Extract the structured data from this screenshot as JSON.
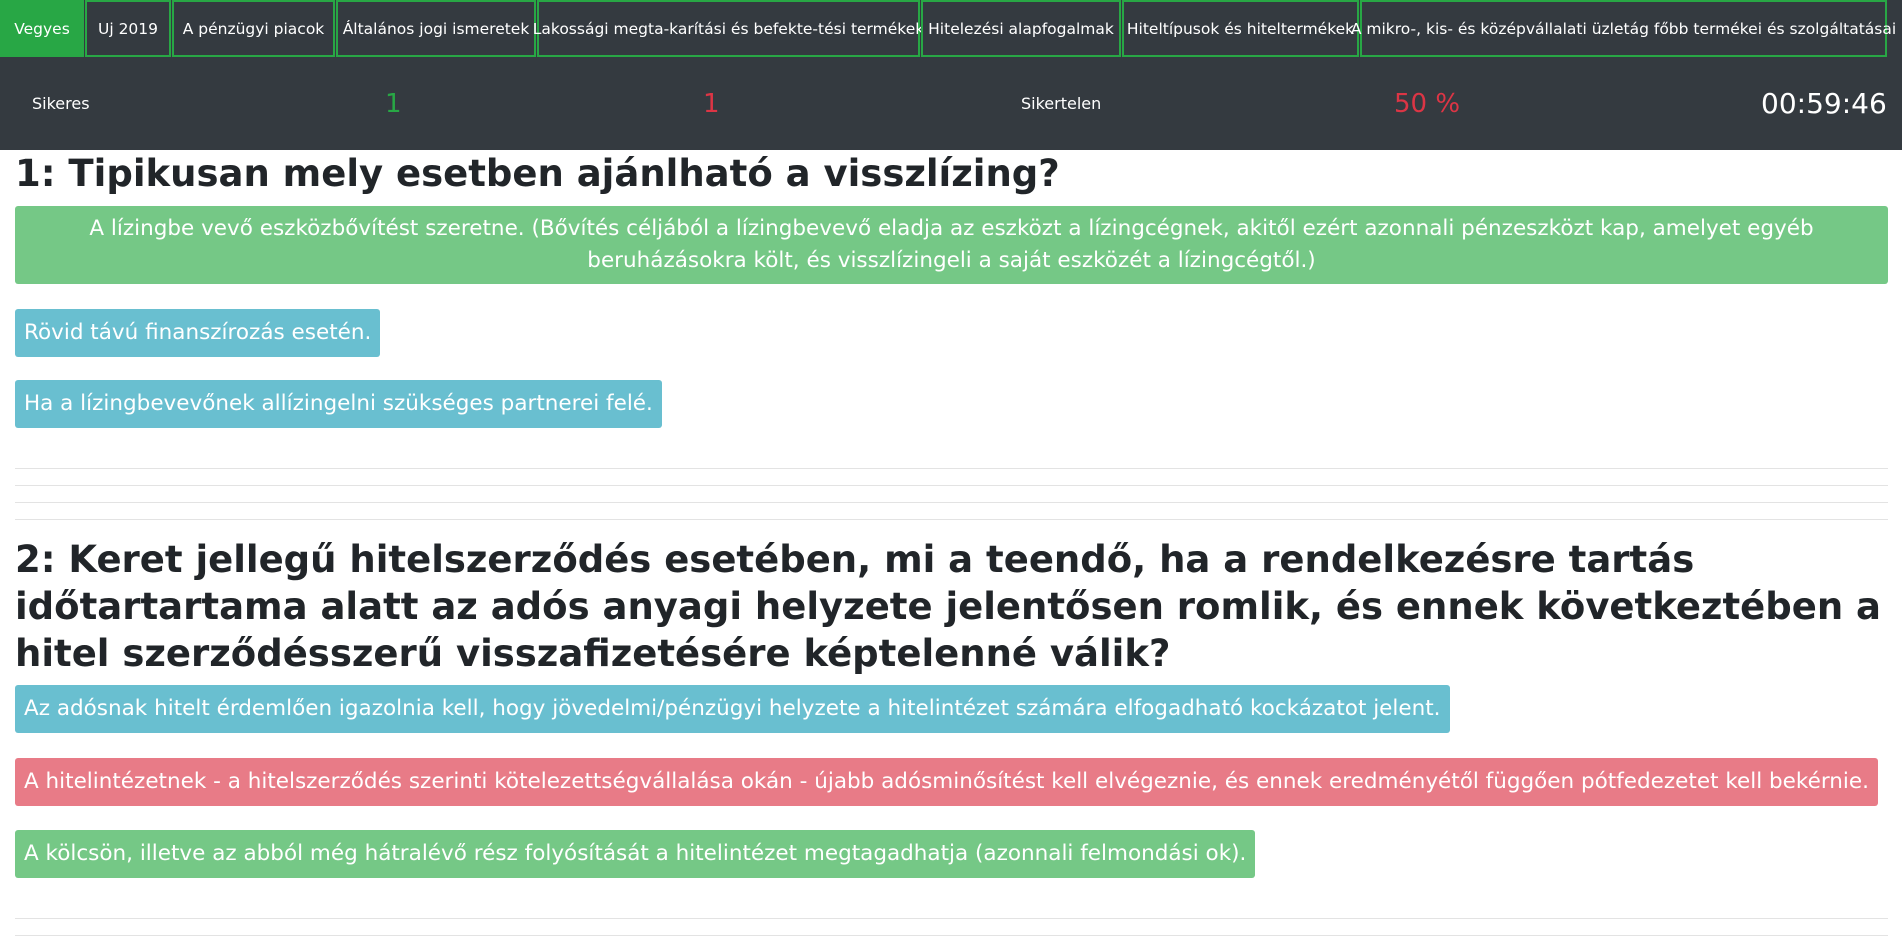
{
  "nav": {
    "tabs": [
      {
        "label": "Vegyes",
        "active": true
      },
      {
        "label": "Uj 2019",
        "active": false
      },
      {
        "label": "A pénzügyi piacok",
        "active": false
      },
      {
        "label": "Általános jogi ismeretek",
        "active": false
      },
      {
        "label": "Lakossági megta-karítási és befekte-tési termékek",
        "active": false
      },
      {
        "label": "Hitelezési alapfogalmak",
        "active": false
      },
      {
        "label": "Hiteltípusok és hiteltermékek",
        "active": false
      },
      {
        "label": "A mikro-, kis- és középvállalati üzletág főbb termékei és szolgáltatásai",
        "active": false
      }
    ]
  },
  "stats": {
    "success_label": "Sikeres",
    "success_count": "1",
    "fail_count": "1",
    "fail_label": "Sikertelen",
    "percent": "50 %",
    "timer": "00:59:46"
  },
  "questions": [
    {
      "title": "1: Tipikusan mely esetben ajánlható a visszlízing?",
      "answers": [
        {
          "text": "A lízingbe vevő eszközbővítést szeretne. (Bővítés céljából a lízingbevevő eladja az eszközt a lízingcégnek, akitől ezért azonnali pénzeszközt kap, amelyet egyéb beruházásokra költ, és visszlízingeli a saját eszközét a lízingcégtől.)",
          "status": "correct"
        },
        {
          "text": "Rövid távú finanszírozás esetén.",
          "status": "neutral"
        },
        {
          "text": "Ha a lízingbevevőnek allízingelni szükséges partnerei felé.",
          "status": "neutral"
        }
      ]
    },
    {
      "title": "2: Keret jellegű hitelszerződés esetében, mi a teendő, ha a rendelkezésre tartás időtartartama alatt az adós anyagi helyzete jelentősen romlik, és ennek következtében a hitel szerződésszerű visszafizetésére képtelenné válik?",
      "answers": [
        {
          "text": "Az adósnak hitelt érdemlően igazolnia kell, hogy jövedelmi/pénzügyi helyzete a hitelintézet számára elfogadható kockázatot jelent.",
          "status": "neutral"
        },
        {
          "text": "A hitelintézetnek - a hitelszerződés szerinti kötelezettségvállalása okán - újabb adósminősítést kell elvégeznie, és ennek eredményétől függően pótfedezetet kell bekérnie.",
          "status": "wrong"
        },
        {
          "text": "A kölcsön, illetve az abból még hátralévő rész folyósítását a hitelintézet megtagadhatja (azonnali felmondási ok).",
          "status": "correct"
        }
      ]
    }
  ],
  "colors": {
    "nav_bg": "#343a40",
    "accent_green": "#28a745",
    "correct": "#75c886",
    "neutral": "#69bfd0",
    "wrong": "#e87b87",
    "fail_red": "#dc3545"
  }
}
